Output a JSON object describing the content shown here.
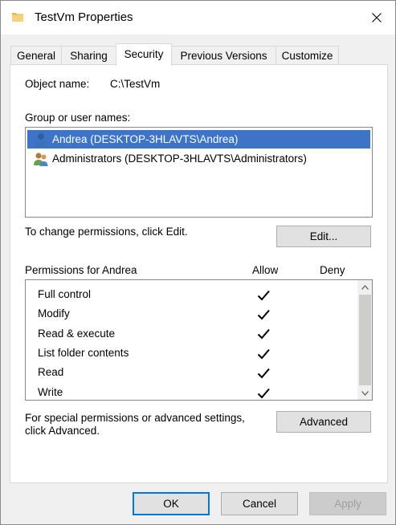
{
  "window": {
    "title": "TestVm Properties"
  },
  "tabs": [
    {
      "label": "General"
    },
    {
      "label": "Sharing"
    },
    {
      "label": "Security"
    },
    {
      "label": "Previous Versions"
    },
    {
      "label": "Customize"
    }
  ],
  "object": {
    "label": "Object name:",
    "value": "C:\\TestVm"
  },
  "group_users": {
    "label": "Group or user names:",
    "items": [
      {
        "name": "Andrea (DESKTOP-3HLAVTS\\Andrea)",
        "icon": "user-icon",
        "selected": true
      },
      {
        "name": "Administrators (DESKTOP-3HLAVTS\\Administrators)",
        "icon": "group-icon",
        "selected": false
      }
    ]
  },
  "change_hint": "To change permissions, click Edit.",
  "edit_button": "Edit...",
  "permissions": {
    "label": "Permissions for Andrea",
    "allow_header": "Allow",
    "deny_header": "Deny",
    "rows": [
      {
        "name": "Full control",
        "allow": true,
        "deny": false
      },
      {
        "name": "Modify",
        "allow": true,
        "deny": false
      },
      {
        "name": "Read & execute",
        "allow": true,
        "deny": false
      },
      {
        "name": "List folder contents",
        "allow": true,
        "deny": false
      },
      {
        "name": "Read",
        "allow": true,
        "deny": false
      },
      {
        "name": "Write",
        "allow": true,
        "deny": false
      }
    ]
  },
  "special_hint_line1": "For special permissions or advanced settings,",
  "special_hint_line2": "click Advanced.",
  "advanced_button": "Advanced",
  "footer": {
    "ok": "OK",
    "cancel": "Cancel",
    "apply": "Apply"
  },
  "colors": {
    "selection": "#3d74c7",
    "default_button_border": "#0078d7"
  }
}
